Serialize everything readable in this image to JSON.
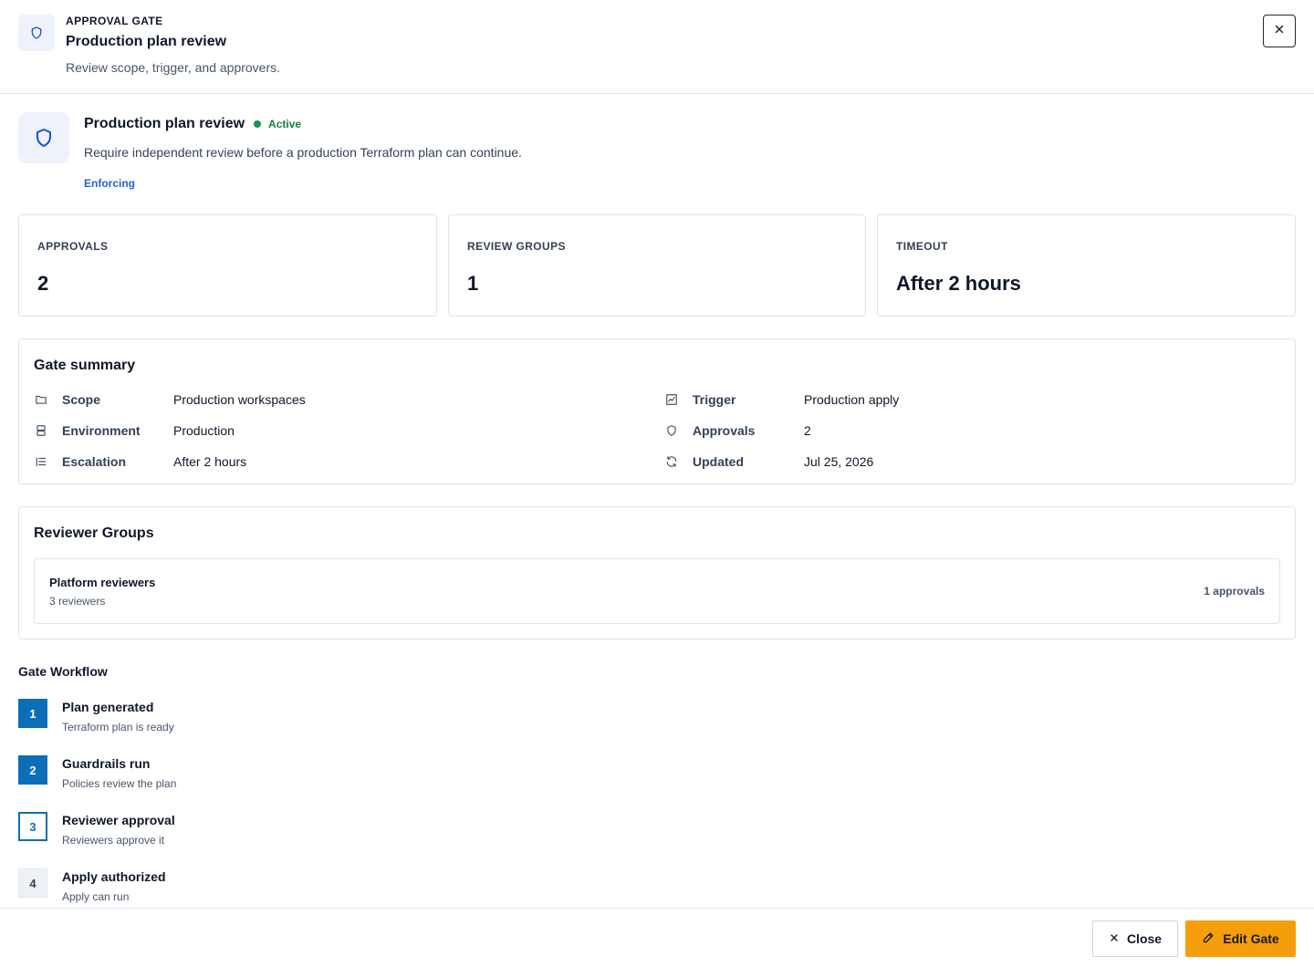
{
  "header": {
    "eyebrow": "APPROVAL GATE",
    "title": "Production plan review",
    "subtitle": "Review scope, trigger, and approvers.",
    "icon": "shield-icon",
    "close_icon": "close-icon"
  },
  "overview": {
    "title": "Production plan review",
    "status": "Active",
    "status_color": "#15935b",
    "description": "Require independent review before a production Terraform plan can continue.",
    "mode": "Enforcing"
  },
  "stats": [
    {
      "label": "APPROVALS",
      "value": "2"
    },
    {
      "label": "REVIEW GROUPS",
      "value": "1"
    },
    {
      "label": "TIMEOUT",
      "value": "After 2 hours"
    }
  ],
  "summary": {
    "title": "Gate summary",
    "rows": [
      {
        "icon": "folder-icon",
        "label": "Scope",
        "value": "Production workspaces"
      },
      {
        "icon": "server-icon",
        "label": "Environment",
        "value": "Production"
      },
      {
        "icon": "list-icon",
        "label": "Escalation",
        "value": "After 2 hours"
      },
      {
        "icon": "chart-icon",
        "label": "Trigger",
        "value": "Production apply"
      },
      {
        "icon": "shield-icon",
        "label": "Approvals",
        "value": "2"
      },
      {
        "icon": "refresh-icon",
        "label": "Updated",
        "value": "Jul 25, 2026"
      }
    ]
  },
  "reviewer_groups": {
    "title": "Reviewer Groups",
    "groups": [
      {
        "name": "Platform reviewers",
        "reviewers": "3 reviewers",
        "approvals": "1 approvals"
      }
    ]
  },
  "workflow": {
    "title": "Gate Workflow",
    "steps": [
      {
        "number": "1",
        "title": "Plan generated",
        "subtitle": "Terraform plan is ready",
        "state": "done"
      },
      {
        "number": "2",
        "title": "Guardrails run",
        "subtitle": "Policies review the plan",
        "state": "done"
      },
      {
        "number": "3",
        "title": "Reviewer approval",
        "subtitle": "Reviewers approve it",
        "state": "current"
      },
      {
        "number": "4",
        "title": "Apply authorized",
        "subtitle": "Apply can run",
        "state": "pending"
      }
    ]
  },
  "footer": {
    "close_label": "Close",
    "edit_label": "Edit Gate",
    "accent_color": "#f59e0b"
  }
}
